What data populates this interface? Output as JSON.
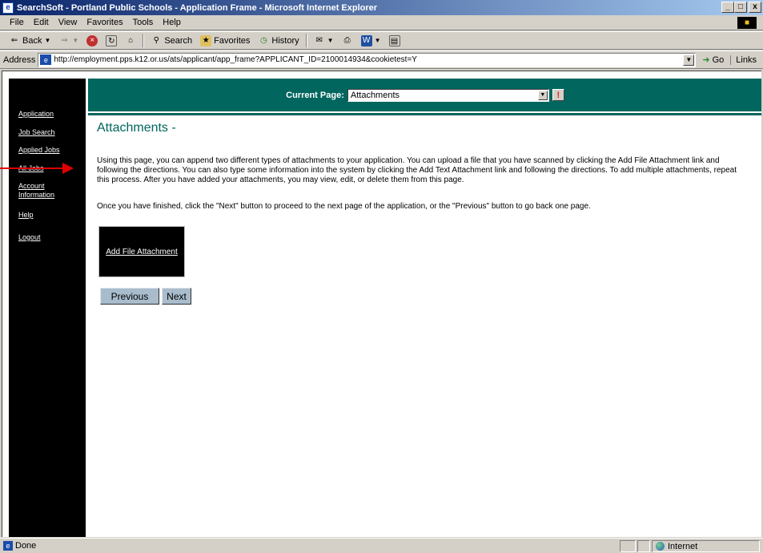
{
  "window": {
    "title": "SearchSoft - Portland Public Schools - Application Frame - Microsoft Internet Explorer",
    "min_label": "_",
    "max_label": "□",
    "close_label": "x"
  },
  "menubar": {
    "items": [
      "File",
      "Edit",
      "View",
      "Favorites",
      "Tools",
      "Help"
    ]
  },
  "toolbar": {
    "back": "Back",
    "search": "Search",
    "favorites": "Favorites",
    "history": "History"
  },
  "address": {
    "label": "Address",
    "url": "http://employment.pps.k12.or.us/ats/applicant/app_frame?APPLICANT_ID=2100014934&cookietest=Y",
    "go": "Go",
    "links": "Links"
  },
  "nav": {
    "items": [
      "Application",
      "Job Search",
      "Applied Jobs",
      "All Jobs",
      "Account Information",
      "Help",
      "Logout"
    ],
    "account_line1": "Account",
    "account_line2": "Information"
  },
  "banner": {
    "current_page_label": "Current Page:",
    "current_page_value": "Attachments",
    "go_symbol": "!"
  },
  "main": {
    "title": "Attachments -",
    "intro": "Using this page, you can append two different types of attachments to your application. You can upload a file that you have scanned by clicking the Add File Attachment link and following the directions. You can also type some information into the system by clicking the Add Text Attachment link and following the directions. To add multiple attachments, repeat this process. After you have added your attachments, you may view, edit, or delete them from this page.",
    "instruction": "Once you have finished, click the \"Next\" button to proceed to the next page of the application, or the \"Previous\" button to go back one page.",
    "add_file_link": "Add File Attachment",
    "previous_label": "Previous",
    "next_label": "Next"
  },
  "status": {
    "text": "Done",
    "zone": "Internet"
  },
  "colors": {
    "accent_teal": "#00665e",
    "nav_black": "#000000",
    "button_blue_gray": "#a8bccc",
    "annotation_red": "#e00000"
  }
}
